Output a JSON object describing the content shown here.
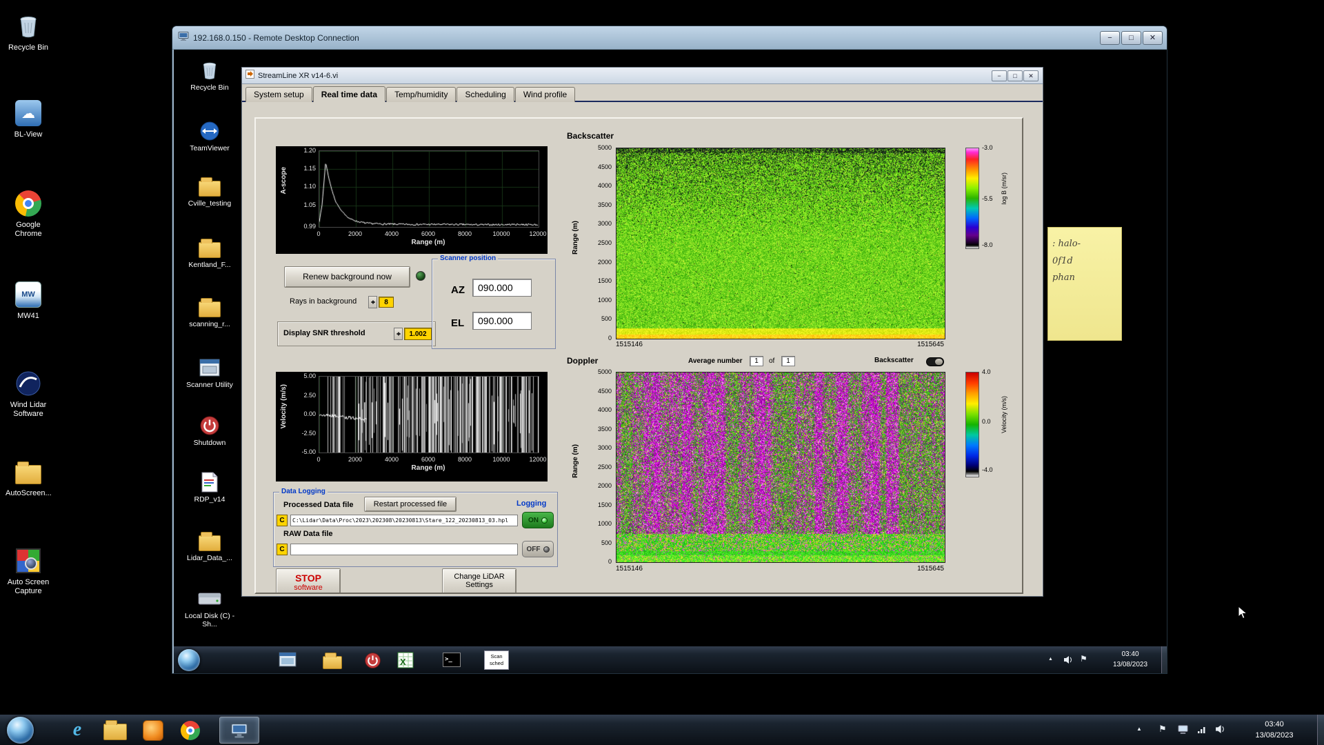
{
  "host": {
    "desktop_icons": [
      {
        "label": "Recycle Bin"
      },
      {
        "label": "BL-View"
      },
      {
        "label": "Google Chrome"
      },
      {
        "label": "MW41"
      },
      {
        "label": "Wind Lidar Software"
      },
      {
        "label": "AutoScreen..."
      },
      {
        "label": "Auto Screen Capture"
      }
    ],
    "taskbar": {
      "time": "03:40",
      "date": "13/08/2023"
    }
  },
  "rdp": {
    "title": "192.168.0.150 - Remote Desktop Connection",
    "desktop_icons": [
      {
        "label": "Recycle Bin"
      },
      {
        "label": "TeamViewer"
      },
      {
        "label": "Cville_testing"
      },
      {
        "label": "Kentland_F..."
      },
      {
        "label": "scanning_r..."
      },
      {
        "label": "Scanner Utility"
      },
      {
        "label": "Shutdown"
      },
      {
        "label": "RDP_v14"
      },
      {
        "label": "Lidar_Data_..."
      },
      {
        "label": "Local Disk (C) - Sh..."
      }
    ],
    "sticky_note": {
      "lines": [
        ": halo-",
        "0f1d",
        "phan"
      ]
    },
    "taskbar": {
      "time": "03:40",
      "date": "13/08/2023",
      "scan_label": "Scan sched"
    }
  },
  "labview": {
    "title": "StreamLine XR v14-6.vi",
    "tabs": [
      "System setup",
      "Real time data",
      "Temp/humidity",
      "Scheduling",
      "Wind profile"
    ],
    "renew_button": "Renew background now",
    "rays_label": "Rays in background",
    "rays_value": "8",
    "snr_label": "Display SNR threshold",
    "snr_value": "1.002",
    "scanner": {
      "title": "Scanner position",
      "az": "AZ",
      "az_value": "090.000",
      "el": "EL",
      "el_value": "090.000"
    },
    "logging": {
      "title": "Data Logging",
      "processed_label": "Processed Data file",
      "restart_button": "Restart processed file",
      "logging_label": "Logging",
      "drive": "C",
      "processed_path": "C:\\Lidar\\Data\\Proc\\2023\\202308\\20230813\\Stare_122_20230813_03.hpl",
      "on": "ON",
      "raw_label": "RAW Data file",
      "raw_path": "",
      "off": "OFF"
    },
    "stop_button": {
      "line1": "STOP",
      "line2": "software"
    },
    "change_button": {
      "line1": "Change LiDAR",
      "line2": "Settings"
    },
    "doppler_header": {
      "avg_label": "Average number",
      "avg_value": "1",
      "of": "of",
      "count": "1",
      "toggle_label": "Backscatter"
    },
    "colors": {
      "panel": "#d6d2c8",
      "value_field_yellow": "#ffd400",
      "logging_on_green": "#2e9e2e",
      "group_title_blue": "#0038c8",
      "stop_red": "#cc0000"
    }
  },
  "chart_data": [
    {
      "id": "ascope",
      "type": "line",
      "ylabel": "A-scope",
      "xlabel": "Range (m)",
      "xlim": [
        0,
        12000
      ],
      "ylim": [
        0.99,
        1.2
      ],
      "yticks": [
        1.2,
        1.15,
        1.1,
        1.05,
        0.99
      ],
      "ytick_labels": [
        "1.20",
        "1.15",
        "1.10",
        "1.05",
        "0.99"
      ],
      "xticks": [
        0,
        2000,
        4000,
        6000,
        8000,
        10000,
        12000
      ],
      "x": [
        0,
        150,
        350,
        500,
        700,
        900,
        1200,
        1600,
        2000,
        2600,
        3500,
        5000,
        7000,
        9000,
        11000,
        12000
      ],
      "y": [
        1.005,
        1.05,
        1.17,
        1.13,
        1.09,
        1.06,
        1.035,
        1.015,
        1.006,
        1.0,
        0.998,
        0.997,
        0.997,
        0.996,
        0.997,
        0.996
      ],
      "line_color": "#ffffff",
      "bg": "#000000"
    },
    {
      "id": "velocity",
      "type": "line",
      "ylabel": "Velocity (m/s)",
      "xlabel": "Range (m)",
      "xlim": [
        0,
        12000
      ],
      "ylim": [
        -5,
        5
      ],
      "yticks": [
        5,
        2.5,
        0,
        -2.5,
        -5
      ],
      "ytick_labels": [
        "5.00",
        "2.50",
        "0.00",
        "-2.50",
        "-5.00"
      ],
      "xticks": [
        0,
        2000,
        4000,
        6000,
        8000,
        10000,
        12000
      ],
      "description": "coherent white trace near 0 m/s out to ~2500 m; saturated full-scale white noise bars at farther ranges",
      "line_color": "#ffffff",
      "bg": "#000000"
    },
    {
      "id": "backscatter",
      "type": "heatmap",
      "title": "Backscatter",
      "ylabel": "Range (m)",
      "ylim": [
        0,
        5000
      ],
      "ytick_labels": [
        "5000",
        "4500",
        "4000",
        "3500",
        "3000",
        "2500",
        "2000",
        "1500",
        "1000",
        "500",
        "0"
      ],
      "xtick_labels": [
        "1515146",
        "1515645"
      ],
      "colorbar": {
        "label": "log B (m/sr)",
        "tick_labels": [
          "-3.0",
          "-5.5",
          "-8.0"
        ]
      },
      "description": "mostly uniform green (~-5.5) backscatter with dark speckle increasing above ~2500 m and a bright yellow aerosol layer below ~300 m"
    },
    {
      "id": "doppler",
      "type": "heatmap",
      "title": "Doppler",
      "ylabel": "Range (m)",
      "ylim": [
        0,
        5000
      ],
      "ytick_labels": [
        "5000",
        "4500",
        "4000",
        "3500",
        "3000",
        "2500",
        "2000",
        "1500",
        "1000",
        "500",
        "0"
      ],
      "xtick_labels": [
        "1515146",
        "1515645"
      ],
      "colorbar": {
        "label": "Velocity (m/s)",
        "tick_labels": [
          "4.0",
          "0.0",
          "-4.0"
        ]
      },
      "description": "green low-velocity boundary layer below ~800 m; noisy magenta/pink vertical streaks (low SNR) above"
    }
  ]
}
